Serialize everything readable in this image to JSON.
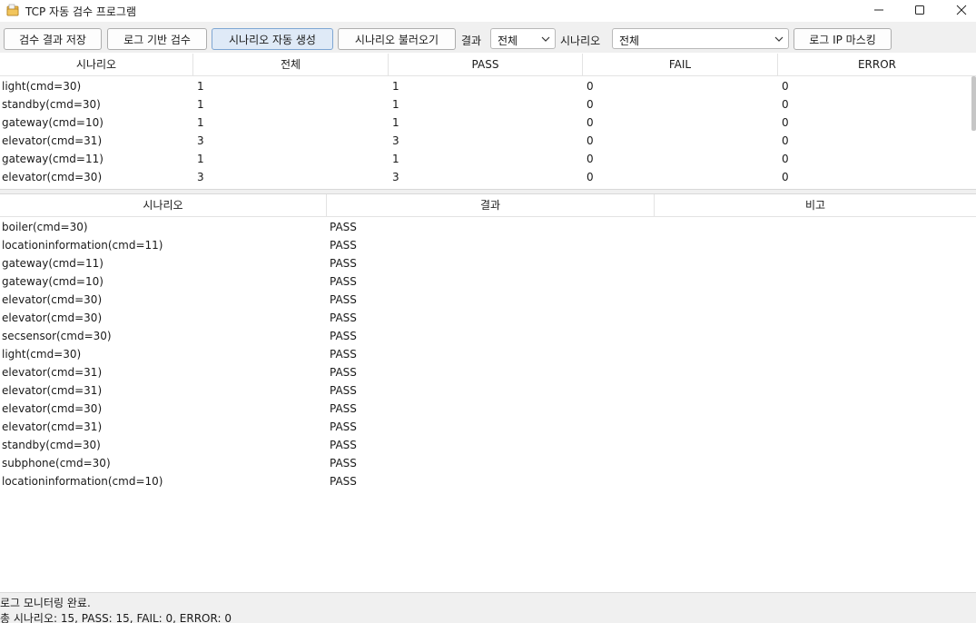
{
  "window": {
    "title": "TCP 자동 검수 프로그램",
    "app_icon": "folder-icon",
    "controls": [
      "minimize-icon",
      "maximize-icon",
      "close-icon"
    ]
  },
  "toolbar": {
    "save_results": "검수 결과 저장",
    "log_based_check": "로그 기반 검수",
    "auto_generate": "시나리오 자동 생성",
    "load_scenario": "시나리오 불러오기",
    "result_label": "결과",
    "result_value": "전체",
    "scenario_label": "시나리오",
    "scenario_value": "전체",
    "ip_masking": "로그 IP 마스킹",
    "active_color": "#dfeaf7"
  },
  "summary_table": {
    "headers": [
      "시나리오",
      "전체",
      "PASS",
      "FAIL",
      "ERROR"
    ],
    "rows": [
      [
        "light(cmd=30)",
        "1",
        "1",
        "0",
        "0"
      ],
      [
        "standby(cmd=30)",
        "1",
        "1",
        "0",
        "0"
      ],
      [
        "gateway(cmd=10)",
        "1",
        "1",
        "0",
        "0"
      ],
      [
        "elevator(cmd=31)",
        "3",
        "3",
        "0",
        "0"
      ],
      [
        "gateway(cmd=11)",
        "1",
        "1",
        "0",
        "0"
      ],
      [
        "elevator(cmd=30)",
        "3",
        "3",
        "0",
        "0"
      ]
    ]
  },
  "detail_table": {
    "headers": [
      "시나리오",
      "결과",
      "비고"
    ],
    "rows": [
      [
        "boiler(cmd=30)",
        "PASS",
        ""
      ],
      [
        "locationinformation(cmd=11)",
        "PASS",
        ""
      ],
      [
        "gateway(cmd=11)",
        "PASS",
        ""
      ],
      [
        "gateway(cmd=10)",
        "PASS",
        ""
      ],
      [
        "elevator(cmd=30)",
        "PASS",
        ""
      ],
      [
        "elevator(cmd=30)",
        "PASS",
        ""
      ],
      [
        "secsensor(cmd=30)",
        "PASS",
        ""
      ],
      [
        "light(cmd=30)",
        "PASS",
        ""
      ],
      [
        "elevator(cmd=31)",
        "PASS",
        ""
      ],
      [
        "elevator(cmd=31)",
        "PASS",
        ""
      ],
      [
        "elevator(cmd=30)",
        "PASS",
        ""
      ],
      [
        "elevator(cmd=31)",
        "PASS",
        ""
      ],
      [
        "standby(cmd=30)",
        "PASS",
        ""
      ],
      [
        "subphone(cmd=30)",
        "PASS",
        ""
      ],
      [
        "locationinformation(cmd=10)",
        "PASS",
        ""
      ]
    ]
  },
  "status": {
    "line1": "로그 모니터링 완료.",
    "line2": "총 시나리오: 15, PASS: 15, FAIL: 0, ERROR: 0"
  }
}
